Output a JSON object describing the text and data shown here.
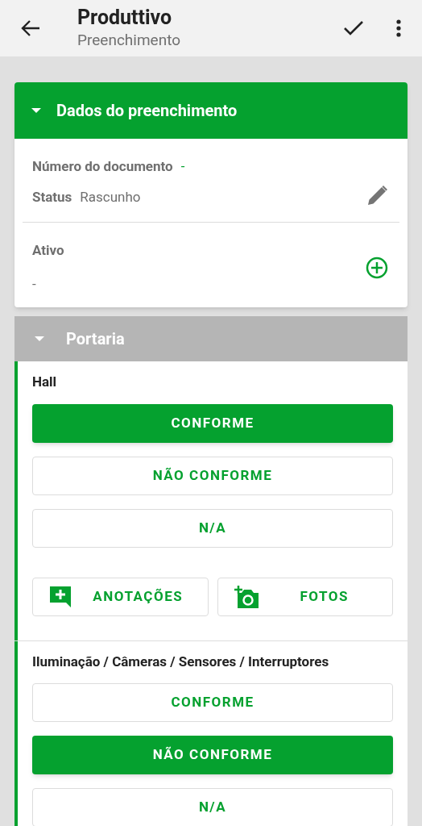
{
  "app_bar": {
    "title": "Produttivo",
    "subtitle": "Preenchimento"
  },
  "card": {
    "title": "Dados do preenchimento",
    "expanded": true,
    "document_label": "Número do documento",
    "document_value": "-",
    "status_label": "Status",
    "status_value": "Rascunho",
    "asset_label": "Ativo",
    "asset_value": "-"
  },
  "section": {
    "title": "Portaria",
    "expanded": true,
    "items": [
      {
        "title": "Hall",
        "options": [
          {
            "label": "CONFORME",
            "selected": true
          },
          {
            "label": "NÃO CONFORME",
            "selected": false
          },
          {
            "label": "N/A",
            "selected": false
          }
        ],
        "actions": [
          {
            "kind": "notes",
            "label": "ANOTAÇÕES"
          },
          {
            "kind": "photos",
            "label": "FOTOS"
          }
        ]
      },
      {
        "title": "Iluminação / Câmeras / Sensores / Interruptores",
        "options": [
          {
            "label": "CONFORME",
            "selected": false
          },
          {
            "label": "NÃO CONFORME",
            "selected": true
          },
          {
            "label": "N/A",
            "selected": false
          }
        ]
      }
    ]
  }
}
